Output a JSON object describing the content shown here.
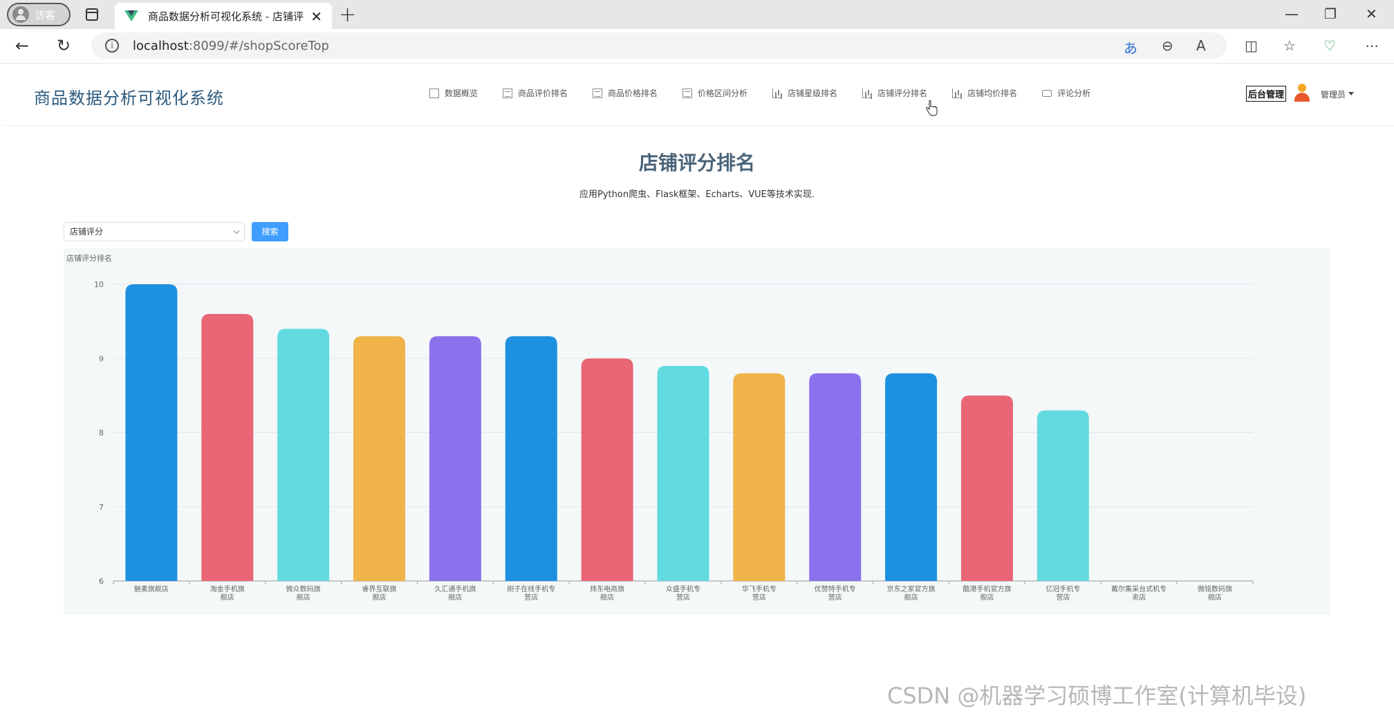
{
  "browser": {
    "guest_label": "访客",
    "tab_title": "商品数据分析可视化系统 - 店铺评",
    "url_host": "localhost",
    "url_path": ":8099/#/shopScoreTop"
  },
  "header": {
    "logo": "商品数据分析可视化系统",
    "menu": [
      {
        "label": "数据概览",
        "icon": "copy-icon"
      },
      {
        "label": "商品评价排名",
        "icon": "document-icon"
      },
      {
        "label": "商品价格排名",
        "icon": "document-icon"
      },
      {
        "label": "价格区间分析",
        "icon": "document-icon"
      },
      {
        "label": "店铺星级排名",
        "icon": "bar-chart-icon"
      },
      {
        "label": "店铺评分排名",
        "icon": "bar-chart-icon"
      },
      {
        "label": "店铺均价排名",
        "icon": "bar-chart-icon"
      },
      {
        "label": "评论分析",
        "icon": "comment-icon"
      }
    ],
    "admin_label": "后台管理",
    "user_name": "管理员"
  },
  "page": {
    "title": "店铺评分排名",
    "subtitle": "应用Python爬虫、Flask框架、Echarts、VUE等技术实现.",
    "select_value": "店铺评分",
    "search_label": "搜索"
  },
  "watermark": "CSDN @机器学习硕博工作室(计算机毕设)",
  "chart_data": {
    "type": "bar",
    "title": "店铺评分排名",
    "categories": [
      "魅素旗舰店",
      "淘金手机旗舰店",
      "微众数码旗舰店",
      "睿界互联旗舰店",
      "久汇通手机旗舰店",
      "刚子在线手机专营店",
      "炜东电商旗舰店",
      "众盛手机专营店",
      "华飞手机专营店",
      "优赞特手机专营店",
      "京东之家官方旗舰店",
      "酷港手机官方旗舰店",
      "亿冠手机专营店",
      "戴尔集采台式机专卖店",
      "微铭数码旗舰店"
    ],
    "values": [
      10,
      9.6,
      9.4,
      9.3,
      9.3,
      9.3,
      9.0,
      8.9,
      8.8,
      8.8,
      8.8,
      8.5,
      8.3,
      null,
      null
    ],
    "ylim": [
      6,
      10
    ],
    "yticks": [
      6,
      7,
      8,
      9,
      10
    ],
    "colors": [
      "#1e90e0",
      "#e96676",
      "#62dbe0",
      "#f0b44a",
      "#8b72ed"
    ],
    "grid": true
  }
}
